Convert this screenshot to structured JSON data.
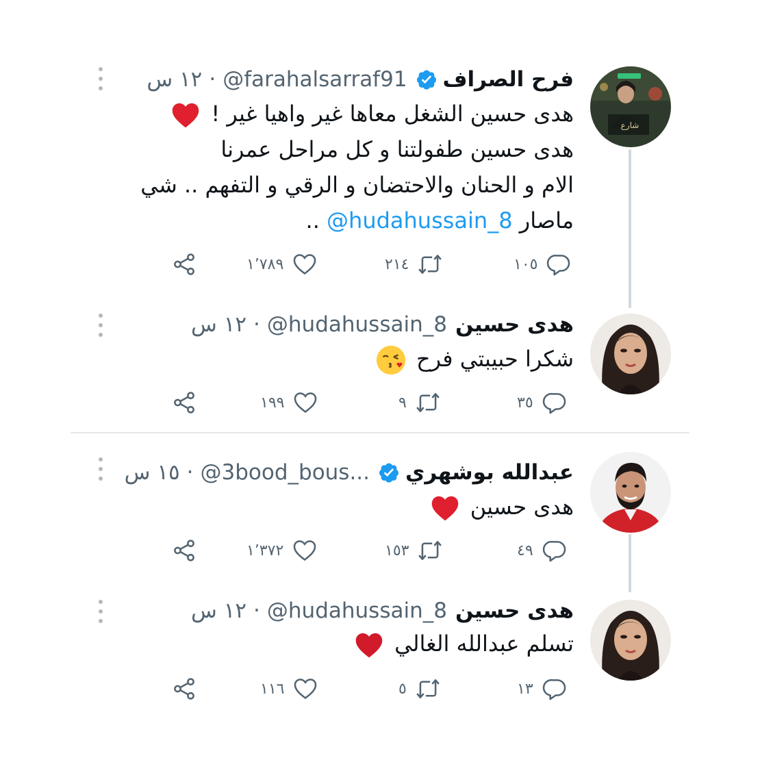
{
  "tweets": [
    {
      "name": "فرح الصراف",
      "verified": true,
      "handle": "@farahalsarraf91",
      "separator": "·",
      "time": "١٢ س",
      "lines": [
        "هدى حسين الشغل معاها غير واهيا غير !",
        "هدى حسين طفولتنا و كل مراحل عمرنا",
        "الام و الحنان والاحتضان و الرقي و التفهم .. شي",
        "ماصار"
      ],
      "mention": "@hudahussain_8",
      "tail": "..",
      "replies": "١٠٥",
      "retweets": "٢١٤",
      "likes": "١٬٧٨٩",
      "avatar_icon": "poster-avatar-icon"
    },
    {
      "name": "هدى حسين",
      "verified": false,
      "handle": "@hudahussain_8",
      "separator": "·",
      "time": "١٢ س",
      "lines": [
        "شكرا حبيبتي فرح"
      ],
      "replies": "٣٥",
      "retweets": "٩",
      "likes": "١٩٩",
      "avatar_icon": "woman-portrait-avatar-icon"
    },
    {
      "name": "عبدالله بوشهري",
      "verified": true,
      "handle": "@3bood_bous...",
      "separator": "·",
      "time": "١٥ س",
      "lines": [
        "هدى حسين"
      ],
      "replies": "٤٩",
      "retweets": "١٥٣",
      "likes": "١٬٣٧٢",
      "avatar_icon": "man-portrait-avatar-icon"
    },
    {
      "name": "هدى حسين",
      "verified": false,
      "handle": "@hudahussain_8",
      "separator": "·",
      "time": "١٢ س",
      "lines": [
        "تسلم عبدالله الغالي"
      ],
      "replies": "١٣",
      "retweets": "٥",
      "likes": "١١٦",
      "avatar_icon": "woman-portrait-avatar-icon"
    }
  ],
  "colors": {
    "link": "#1d9bf0",
    "verified": "#1d9bf0",
    "muted": "#536471",
    "heart": "#e0202e"
  }
}
